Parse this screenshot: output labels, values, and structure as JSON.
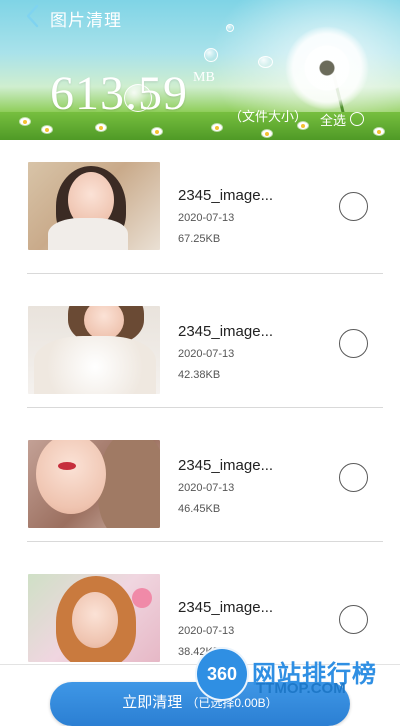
{
  "header": {
    "title": "图片清理",
    "size_value": "613.59",
    "size_unit": "MB",
    "size_caption": "（文件大小）",
    "select_all_label": "全选"
  },
  "images": [
    {
      "name": "2345_image...",
      "date": "2020-07-13",
      "size": "67.25KB",
      "selected": false
    },
    {
      "name": "2345_image...",
      "date": "2020-07-13",
      "size": "42.38KB",
      "selected": false
    },
    {
      "name": "2345_image...",
      "date": "2020-07-13",
      "size": "46.45KB",
      "selected": false
    },
    {
      "name": "2345_image...",
      "date": "2020-07-13",
      "size": "38.42KB",
      "selected": false
    }
  ],
  "footer": {
    "clean_label": "立即清理",
    "selected_summary": "（已选择0.00B）"
  },
  "watermark": {
    "badge": "360",
    "title": "网站排行榜",
    "url": "TTMOP.COM"
  },
  "icons": {
    "back": "chevron-left-icon",
    "select_all": "radio-ring-icon",
    "row_select": "radio-ring-icon"
  },
  "colors": {
    "accent": "#2b7fd3",
    "text_primary": "#222222",
    "text_secondary": "#555555",
    "divider": "#d9d9d9",
    "back_arrow": "#7fd3f0"
  }
}
